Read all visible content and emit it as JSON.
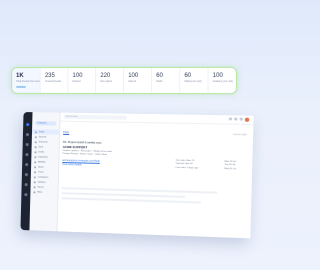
{
  "stats": [
    {
      "value": "1K",
      "label": "Total threads this week",
      "highlight": true
    },
    {
      "value": "235",
      "label": "Unread threads"
    },
    {
      "value": "100",
      "label": "Replied"
    },
    {
      "value": "220",
      "label": "Not replied"
    },
    {
      "value": "100",
      "label": "Starred"
    },
    {
      "value": "60",
      "label": "Drafts"
    },
    {
      "value": "60",
      "label": "Waiting for reply"
    },
    {
      "value": "100",
      "label": "Awaiting your reply"
    }
  ],
  "mail_app": {
    "search_placeholder": "Search mail",
    "compose_label": "Compose",
    "folders": [
      {
        "label": "Inbox",
        "active": true
      },
      {
        "label": "Starred"
      },
      {
        "label": "Snoozed"
      },
      {
        "label": "Sent"
      },
      {
        "label": "Drafts"
      },
      {
        "label": "Important"
      },
      {
        "label": "All Mail"
      },
      {
        "label": "Spam"
      },
      {
        "label": "Trash"
      },
      {
        "label": "Categories"
      },
      {
        "label": "Updates"
      },
      {
        "label": "Social"
      },
      {
        "label": "More"
      }
    ],
    "tabs": [
      {
        "label": "Inbox",
        "active": true
      }
    ],
    "tab_meta": "1-50 of 2,300",
    "message": {
      "subject": "Re: Project kickoff & weekly sync",
      "from": "ACME SUPPORT",
      "line1": "Product updates · Reminders · Reply to this email",
      "line2": "Priority: Normal · Status: Open · Label: Inbox",
      "link": "acmesupport.example.com/help",
      "link2": "View ticket details"
    },
    "meta_left": [
      "Due date: Mon 23",
      "Opened: Sep 18",
      "Last seen: 2 days ago"
    ],
    "meta_right": [
      "Mon 23 Jul",
      "Tue 24 Jul",
      "Wed 25 Jul"
    ]
  }
}
